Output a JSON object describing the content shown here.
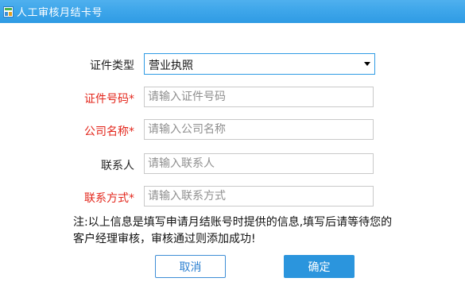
{
  "window": {
    "title": "人工审核月结卡号"
  },
  "form": {
    "cert_type": {
      "label": "证件类型",
      "selected": "营业执照"
    },
    "cert_number": {
      "label": "证件号码*",
      "placeholder": "请输入证件号码",
      "value": ""
    },
    "company_name": {
      "label": "公司名称*",
      "placeholder": "请输入公司名称",
      "value": ""
    },
    "contact_person": {
      "label": "联系人",
      "placeholder": "请输入联系人",
      "value": ""
    },
    "contact_method": {
      "label": "联系方式*",
      "placeholder": "请输入联系方式",
      "value": ""
    }
  },
  "note": {
    "line1": "注:以上信息是填写申请月结账号时提供的信息,填写后请等待您的",
    "line2": "客户经理审核，审核通过则添加成功!"
  },
  "buttons": {
    "cancel_label": "取消",
    "confirm_label": "确定"
  },
  "colors": {
    "titlebar": "#3ea6ea",
    "required_label": "#e3261b",
    "confirm_button": "#2b95dd",
    "cancel_border": "#3e8ed6"
  },
  "icons": {
    "app_icon": "app-window-icon",
    "dropdown": "caret-down-icon"
  }
}
